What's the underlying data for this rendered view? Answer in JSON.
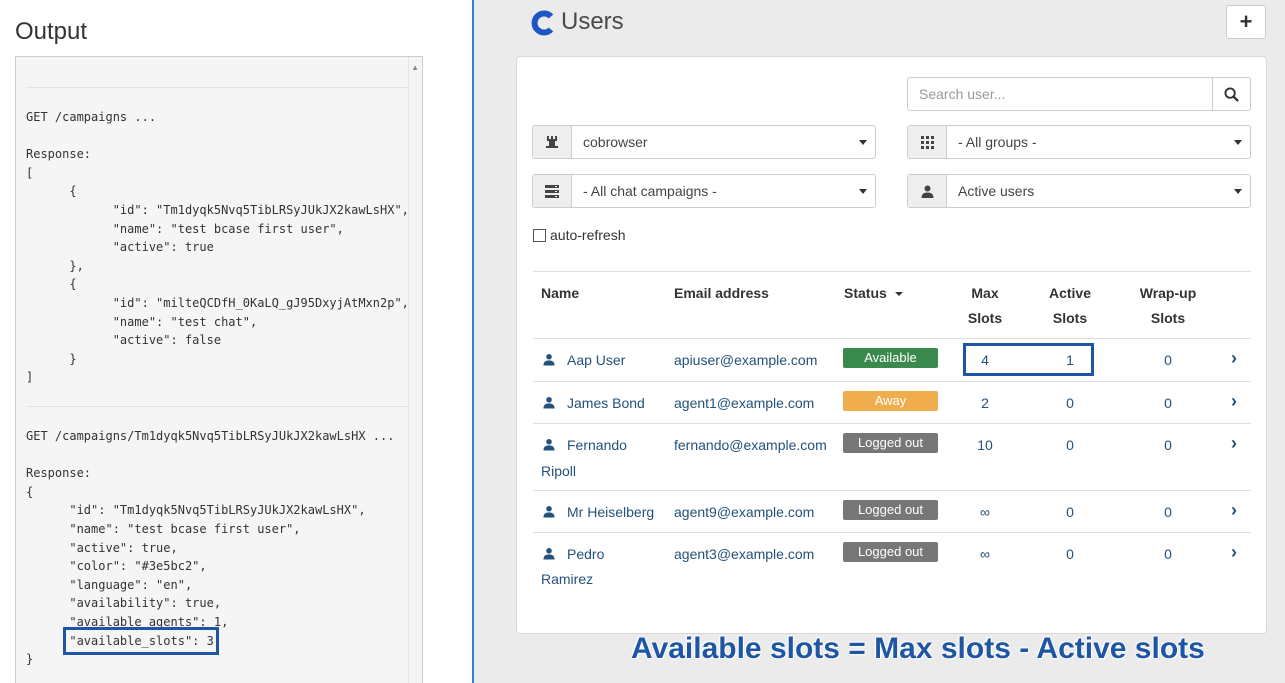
{
  "output": {
    "title": "Output",
    "block1": "GET /campaigns ...\n\nResponse:\n[\n      {\n            \"id\": \"Tm1dyqk5Nvq5TibLRSyJUkJX2kawLsHX\",\n            \"name\": \"test bcase first user\",\n            \"active\": true\n      },\n      {\n            \"id\": \"milteQCDfH_0KaLQ_gJ95DxyjAtMxn2p\",\n            \"name\": \"test chat\",\n            \"active\": false\n      }\n]",
    "block2": "GET /campaigns/Tm1dyqk5Nvq5TibLRSyJUkJX2kawLsHX ...\n\nResponse:\n{\n      \"id\": \"Tm1dyqk5Nvq5TibLRSyJUkJX2kawLsHX\",\n      \"name\": \"test bcase first user\",\n      \"active\": true,\n      \"color\": \"#3e5bc2\",\n      \"language\": \"en\",\n      \"availability\": true,\n      \"available_agents\": 1,\n      \"available_slots\": 3\n}"
  },
  "users": {
    "title": "Users",
    "add_label": "+",
    "search_placeholder": "Search user...",
    "filters": {
      "tenant": "cobrowser",
      "groups": "- All groups -",
      "campaigns": "- All chat campaigns -",
      "user_state": "Active users"
    },
    "autorefresh_label": "auto-refresh",
    "columns": {
      "name": "Name",
      "email": "Email address",
      "status": "Status",
      "max1": "Max",
      "max2": "Slots",
      "active1": "Active",
      "active2": "Slots",
      "wrap1": "Wrap-up",
      "wrap2": "Slots"
    },
    "rows": [
      {
        "name1": "Aap User",
        "name2": "",
        "email": "apiuser@example.com",
        "status": "Available",
        "max": "4",
        "active": "1",
        "wrap": "0"
      },
      {
        "name1": "James Bond",
        "name2": "",
        "email": "agent1@example.com",
        "status": "Away",
        "max": "2",
        "active": "0",
        "wrap": "0"
      },
      {
        "name1": "Fernando",
        "name2": "Ripoll",
        "email": "fernando@example.com",
        "status": "Logged out",
        "max": "10",
        "active": "0",
        "wrap": "0"
      },
      {
        "name1": "Mr Heiselberg",
        "name2": "",
        "email": "agent9@example.com",
        "status": "Logged out",
        "max": "∞",
        "active": "0",
        "wrap": "0"
      },
      {
        "name1": "Pedro",
        "name2": "Ramirez",
        "email": "agent3@example.com",
        "status": "Logged out",
        "max": "∞",
        "active": "0",
        "wrap": "0"
      }
    ]
  },
  "colors": {
    "available": "#3a8a4e",
    "away": "#f0ad4e",
    "logged_out": "#777777",
    "highlight": "#1f56a4",
    "link": "#23527c",
    "logo": "#1f56c4"
  },
  "caption": "Available slots = Max slots - Active slots"
}
